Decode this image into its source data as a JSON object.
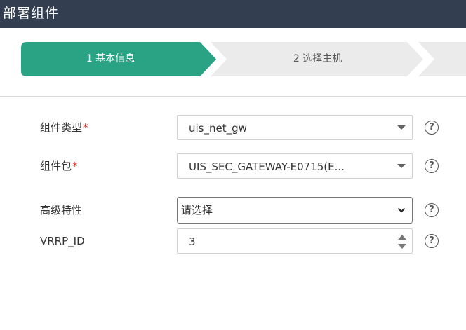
{
  "window": {
    "title": "部署组件"
  },
  "steps": [
    {
      "label": "1 基本信息",
      "state": "active"
    },
    {
      "label": "2 选择主机",
      "state": "inactive"
    },
    {
      "label": "",
      "state": "inactive"
    }
  ],
  "form": {
    "component_type": {
      "label": "组件类型",
      "required": "*",
      "value": "uis_net_gw"
    },
    "component_package": {
      "label": "组件包",
      "required": "*",
      "value": "UIS_SEC_GATEWAY-E0715(E..."
    },
    "advanced_feature": {
      "label": "高级特性",
      "value": "请选择"
    },
    "vrrp_id": {
      "label": "VRRP_ID",
      "value": "3"
    },
    "help_glyph": "?"
  },
  "colors": {
    "titlebar": "#333f50",
    "active_step": "#2aa385",
    "inactive_step": "#ebebeb"
  },
  "icons": [
    "question-circle-icon",
    "caret-down-icon",
    "chevron-down-icon",
    "spinner-arrows-icon"
  ]
}
